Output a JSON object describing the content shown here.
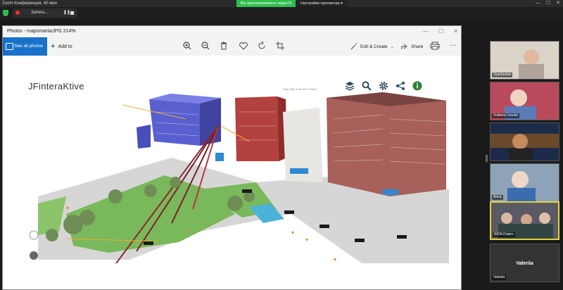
{
  "zoom": {
    "title": "Zoom Конференция, 40 мин",
    "recording_label": "Запись...",
    "pause_glyph": "❚❚",
    "share_banner": "Вы просматриваете экран N",
    "view_options": "Настройки просмотра ▾",
    "win_min": "—",
    "win_max": "☐",
    "win_close": "✕"
  },
  "photos": {
    "title": "Photos - mapsmaniaJPG   214%",
    "see_all_label": "See all photos",
    "add_to_label": "Add to",
    "edit_create_label": "Edit & Create",
    "share_label": "Share",
    "more_glyph": "···",
    "win_min": "—",
    "win_max": "☐",
    "win_close": "✕"
  },
  "map": {
    "logo": "JFinteraKtive",
    "links": "Help   Sign in   ArcGIS Online"
  },
  "participants": [
    {
      "name": "Vyacheslav"
    },
    {
      "name": "Svitlana Ursulai"
    },
    {
      "name": ""
    },
    {
      "name": "Anna"
    },
    {
      "name": "WOA Dnipro"
    },
    {
      "name": "Valeriia",
      "center": "Valeriia"
    }
  ],
  "colors": {
    "zoom_green": "#2fbf4f",
    "photos_blue": "#1971c9",
    "active_speaker": "#e5d33a"
  }
}
